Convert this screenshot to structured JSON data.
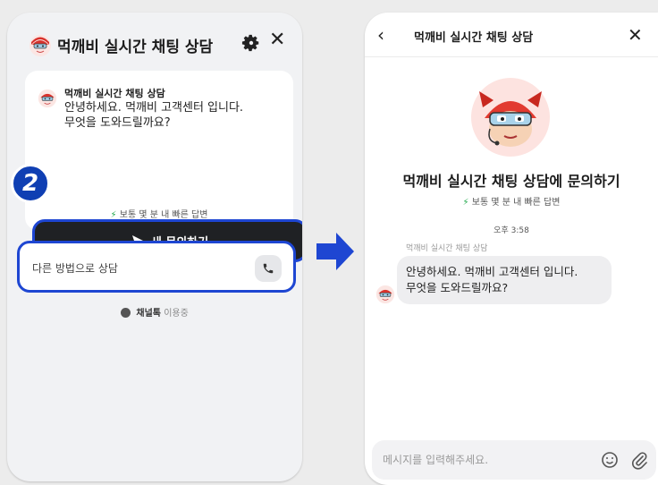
{
  "left_panel": {
    "title": "먹깨비 실시간 채팅 상담",
    "card": {
      "sender": "먹깨비 실시간 채팅 상담",
      "message": "안녕하세요. 먹깨비 고객센터 입니다.\n무엇을 도와드릴까요?"
    },
    "new_chat_label": "새 문의하기",
    "step_badge": "2",
    "reply_speed_text": "보통 몇 분 내 빠른 답변",
    "other_method_label": "다른 방법으로 상담",
    "powered_brand": "채널톡",
    "powered_suffix": "이용중"
  },
  "right_panel": {
    "title": "먹깨비 실시간 채팅 상담",
    "hero_title": "먹깨비 실시간 채팅 상담에 문의하기",
    "reply_speed_text": "보통 몇 분 내 빠른 답변",
    "time": "오후 3:58",
    "sender": "먹깨비 실시간 채팅 상담",
    "message_line1": "안녕하세요. 먹깨비 고객센터 입니다.",
    "message_line2": "무엇을 도와드릴까요?",
    "input_placeholder": "메시지를 입력해주세요."
  },
  "colors": {
    "accent_blue": "#1e46d2",
    "dark_button": "#1f2124",
    "bolt_green": "#1fa84a",
    "mascot_red": "#d8322c"
  }
}
